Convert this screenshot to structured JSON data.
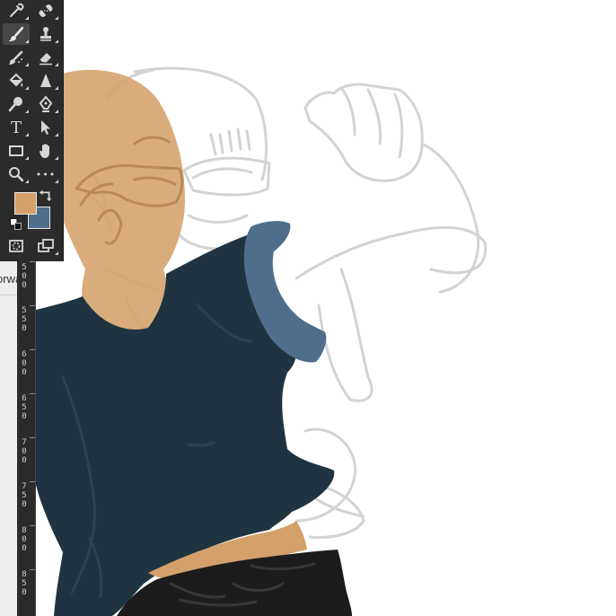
{
  "app": {
    "tools": [
      {
        "name": "eyedropper-tool",
        "icon": "eyedropper-icon"
      },
      {
        "name": "healing-brush-tool",
        "icon": "bandage-icon"
      },
      {
        "name": "brush-tool",
        "icon": "brush-icon",
        "active": true
      },
      {
        "name": "clone-stamp-tool",
        "icon": "stamp-icon"
      },
      {
        "name": "history-brush-tool",
        "icon": "history-brush-icon"
      },
      {
        "name": "eraser-tool",
        "icon": "eraser-icon"
      },
      {
        "name": "paint-bucket-tool",
        "icon": "paint-bucket-icon"
      },
      {
        "name": "blur-tool",
        "icon": "blur-icon"
      },
      {
        "name": "dodge-tool",
        "icon": "dodge-icon"
      },
      {
        "name": "pen-tool",
        "icon": "pen-icon"
      },
      {
        "name": "type-tool",
        "icon": "type-icon",
        "glyph": "T"
      },
      {
        "name": "path-selection-tool",
        "icon": "arrow-icon"
      },
      {
        "name": "rectangle-tool",
        "icon": "rectangle-icon"
      },
      {
        "name": "hand-tool",
        "icon": "hand-icon"
      },
      {
        "name": "zoom-tool",
        "icon": "zoom-icon"
      },
      {
        "name": "more-tools",
        "icon": "ellipsis-icon",
        "glyph": "•••"
      }
    ],
    "colors": {
      "foreground": "#d4a06a",
      "background": "#4e6e8c",
      "shirt": "#1f3440",
      "skin": "#d4a06a",
      "pants": "#1c1c1c",
      "sketch": "#cfcfcf"
    },
    "ruler_labels": [
      "500",
      "550",
      "600",
      "650",
      "700",
      "750",
      "800",
      "850"
    ],
    "left_strip_label": "orwa"
  }
}
